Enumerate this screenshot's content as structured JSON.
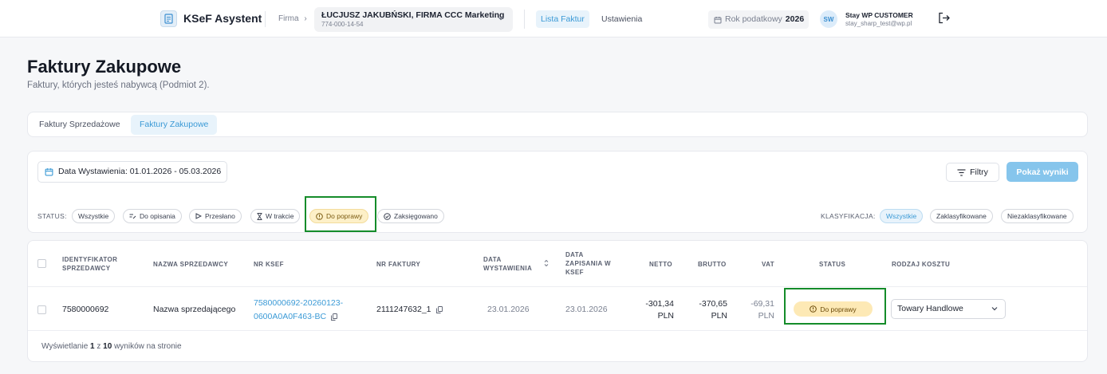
{
  "header": {
    "app_title": "KSeF Asystent",
    "firma_label": "Firma",
    "firma_name": "ŁUCJUSZ JAKUBŃSKI, FIRMA CCC Marketing",
    "firma_nip": "774-000-14-54",
    "nav": [
      "Lista Faktur",
      "Ustawienia"
    ],
    "rok_label": "Rok podatkowy",
    "rok_value": "2026",
    "user_initials": "SW",
    "user_name": "Stay WP CUSTOMER",
    "user_email": "stay_sharp_test@wp.pl"
  },
  "page": {
    "title": "Faktury Zakupowe",
    "subtitle": "Faktury, których jesteś nabywcą (Podmiot 2)."
  },
  "tabs": [
    "Faktury Sprzedażowe",
    "Faktury Zakupowe"
  ],
  "filters": {
    "date_label": "Data Wystawienia: 01.01.2026 - 05.03.2026",
    "filtry_label": "Filtry",
    "pokaz_label": "Pokaż wyniki",
    "status_label": "STATUS:",
    "status_options": [
      "Wszystkie",
      "Do opisania",
      "Przesłano",
      "W trakcie",
      "Do poprawy",
      "Zaksięgowano"
    ],
    "status_selected": "Do poprawy",
    "klasyfikacja_label": "KLASYFIKACJA:",
    "klasyfikacja_options": [
      "Wszystkie",
      "Zaklasyfikowane",
      "Niezaklasyfikowane"
    ],
    "klasyfikacja_selected": "Wszystkie"
  },
  "table": {
    "columns": {
      "identyfikator": [
        "IDENTYFIKATOR",
        "SPRZEDAWCY"
      ],
      "nazwa": "NAZWA SPRZEDAWCY",
      "nr_ksef": "NR KSEF",
      "nr_faktury": "NR FAKTURY",
      "data_wyst": [
        "DATA",
        "WYSTAWIENIA"
      ],
      "data_zap": [
        "DATA",
        "ZAPISANIA W",
        "KSEF"
      ],
      "netto": "NETTO",
      "brutto": "BRUTTO",
      "vat": "VAT",
      "status": "STATUS",
      "rodzaj": "RODZAJ KOSZTU"
    },
    "rows": [
      {
        "identyfikator": "7580000692",
        "nazwa": "Nazwa sprzedającego",
        "nr_ksef_1": "7580000692-20260123-",
        "nr_ksef_2": "0600A0A0F463-BC",
        "nr_faktury": "2111247632_1",
        "data_wyst": "23.01.2026",
        "data_zap": "23.01.2026",
        "netto_1": "-301,34",
        "netto_2": "PLN",
        "brutto_1": "-370,65",
        "brutto_2": "PLN",
        "vat_1": "-69,31",
        "vat_2": "PLN",
        "status": "Do poprawy",
        "rodzaj": "Towary Handlowe"
      }
    ],
    "footer_prefix": "Wyświetlanie",
    "footer_from": "1",
    "footer_mid": "z",
    "footer_total": "10",
    "footer_suffix": "wyników na stronie"
  },
  "colors": {
    "accent": "#3b9ad6",
    "primary_button": "#86c5ec",
    "status_warning_bg": "#fde9b5",
    "highlight_green": "#158c2a"
  }
}
